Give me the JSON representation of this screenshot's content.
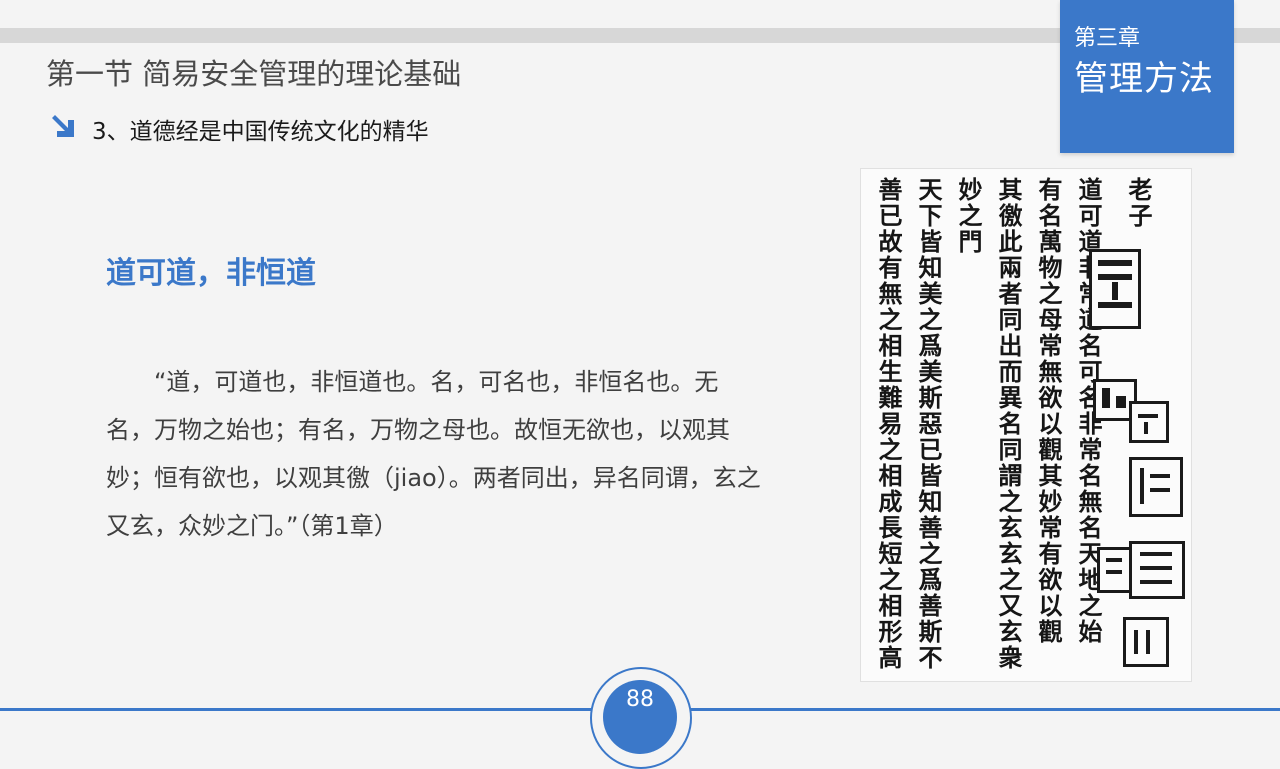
{
  "header": {
    "section_title": "第一节  简易安全管理的理论基础",
    "subtitle": "3、道德经是中国传统文化的精华",
    "chapter_label": "第三章",
    "chapter_name": "管理方法"
  },
  "content": {
    "quote_heading": "道可道，非恒道",
    "body": "“道，可道也，非恒道也。名，可名也，非恒名也。无名，万物之始也；有名，万物之母也。故恒无欲也，以观其妙；恒有欲也，以观其徼（jiao）。两者同出，异名同谓，玄之又玄，众妙之门。”（第1章）"
  },
  "manuscript": {
    "columns": [
      "老子",
      "道可道非常道名可名非常名無名天地之始",
      "有名萬物之母常無欲以觀其妙常有欲以觀",
      "其徼此兩者同出而異名同謂之玄玄之又玄衆",
      "妙之門",
      "天下皆知美之爲美斯惡已皆知善之爲善斯不",
      "善已故有無之相生難易之相成長短之相形高"
    ]
  },
  "footer": {
    "page_number": "88"
  },
  "colors": {
    "accent": "#3b78c9",
    "background": "#f4f4f4",
    "top_bar": "#d7d7d7",
    "body_text": "#3f3f3f"
  },
  "icons": {
    "subtitle_bullet": "arrow-down-right-icon"
  }
}
